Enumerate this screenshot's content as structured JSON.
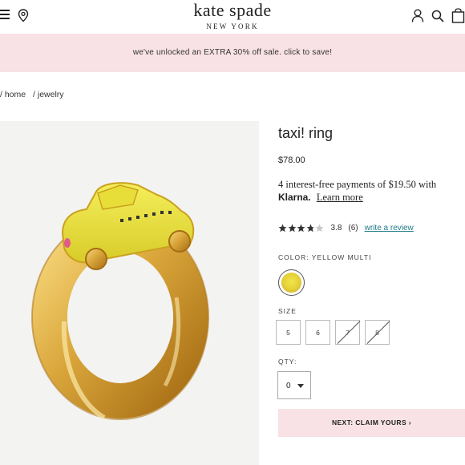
{
  "header": {
    "brand": "kate spade",
    "brand_sub": "NEW YORK",
    "icons": [
      "menu-icon",
      "location-pin-icon",
      "user-icon",
      "search-icon",
      "bag-icon"
    ]
  },
  "promo": {
    "text": "we've unlocked an EXTRA 30% off sale. click to save!",
    "bg_color": "#f8e2e6"
  },
  "breadcrumb": [
    "/ home",
    "/ jewelry"
  ],
  "product": {
    "title": "taxi! ring",
    "price": "$78.00",
    "installments_text": "4 interest-free payments of $19.50 with",
    "klarna_brand": "Klarna.",
    "learn_more": "Learn more",
    "rating": 3.8,
    "rating_value": "3.8",
    "review_count": "(6)",
    "review_link": "write a review",
    "color_label": "COLOR: YELLOW MULTI",
    "size_label": "SIZE",
    "sizes": [
      {
        "label": "5",
        "available": true
      },
      {
        "label": "6",
        "available": true
      },
      {
        "label": "7",
        "available": false
      },
      {
        "label": "8",
        "available": false
      }
    ],
    "qty_label": "QTY:",
    "qty_value": "0",
    "next_button": "NEXT: CLAIM YOURS",
    "next_arrow": "›",
    "accent_link_color": "#1e7a8a"
  }
}
